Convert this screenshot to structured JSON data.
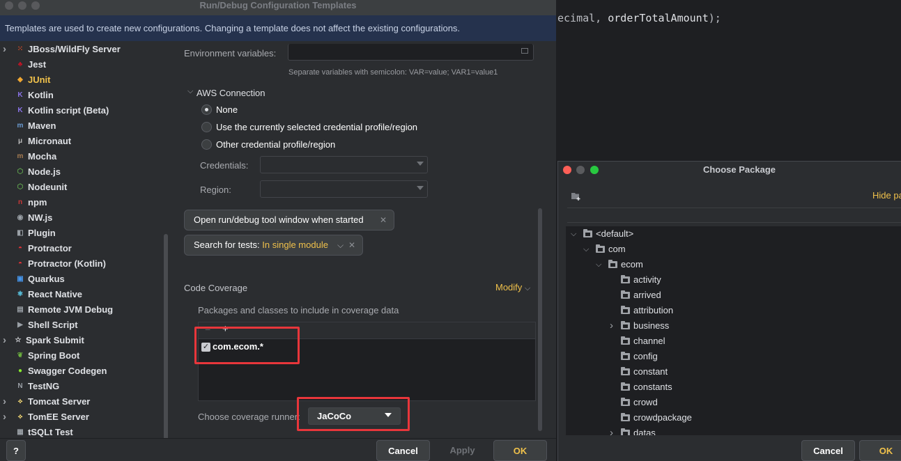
{
  "editor": {
    "code_before": "ecimal, ",
    "code_ident": "orderTotalAmount",
    "code_after": ");"
  },
  "dialog": {
    "title": "Run/Debug Configuration Templates",
    "banner": "Templates are used to create new configurations. Changing a template does not affect the existing configurations."
  },
  "sidebar": {
    "items": [
      {
        "label": "JBoss/WildFly Server",
        "icon": "jboss-icon",
        "expandable": true,
        "color": "#e44d26"
      },
      {
        "label": "Jest",
        "icon": "jest-icon",
        "expandable": false,
        "color": "#c21325"
      },
      {
        "label": "JUnit",
        "icon": "junit-icon",
        "expandable": false,
        "color": "#f0a732",
        "selected": true
      },
      {
        "label": "Kotlin",
        "icon": "kotlin-icon",
        "expandable": false,
        "color": "#8a73e8"
      },
      {
        "label": "Kotlin script (Beta)",
        "icon": "kotlin-script-icon",
        "expandable": false,
        "color": "#8a73e8"
      },
      {
        "label": "Maven",
        "icon": "maven-icon",
        "expandable": false,
        "color": "#6b9bd2"
      },
      {
        "label": "Micronaut",
        "icon": "micronaut-icon",
        "expandable": false,
        "color": "#bbbbbb"
      },
      {
        "label": "Mocha",
        "icon": "mocha-icon",
        "expandable": false,
        "color": "#a67c52"
      },
      {
        "label": "Node.js",
        "icon": "nodejs-icon",
        "expandable": false,
        "color": "#5fa04e"
      },
      {
        "label": "Nodeunit",
        "icon": "nodeunit-icon",
        "expandable": false,
        "color": "#5fa04e"
      },
      {
        "label": "npm",
        "icon": "npm-icon",
        "expandable": false,
        "color": "#cb3837"
      },
      {
        "label": "NW.js",
        "icon": "nwjs-icon",
        "expandable": false,
        "color": "#9aa0a6"
      },
      {
        "label": "Plugin",
        "icon": "plugin-icon",
        "expandable": false,
        "color": "#9aa0a6"
      },
      {
        "label": "Protractor",
        "icon": "protractor-icon",
        "expandable": false,
        "color": "#e23237"
      },
      {
        "label": "Protractor (Kotlin)",
        "icon": "protractor-kotlin-icon",
        "expandable": false,
        "color": "#e23237"
      },
      {
        "label": "Quarkus",
        "icon": "quarkus-icon",
        "expandable": false,
        "color": "#4695eb"
      },
      {
        "label": "React Native",
        "icon": "react-icon",
        "expandable": false,
        "color": "#61dafb"
      },
      {
        "label": "Remote JVM Debug",
        "icon": "remote-debug-icon",
        "expandable": false,
        "color": "#9aa0a6"
      },
      {
        "label": "Shell Script",
        "icon": "shell-icon",
        "expandable": false,
        "color": "#9aa0a6"
      },
      {
        "label": "Spark Submit",
        "icon": "spark-icon",
        "expandable": true,
        "color": "#dfe1e5"
      },
      {
        "label": "Spring Boot",
        "icon": "spring-icon",
        "expandable": false,
        "color": "#6db33f"
      },
      {
        "label": "Swagger Codegen",
        "icon": "swagger-icon",
        "expandable": false,
        "color": "#85ea2d"
      },
      {
        "label": "TestNG",
        "icon": "testng-icon",
        "expandable": false,
        "color": "#9aa0a6"
      },
      {
        "label": "Tomcat Server",
        "icon": "tomcat-icon",
        "expandable": true,
        "color": "#f8dc75"
      },
      {
        "label": "TomEE Server",
        "icon": "tomee-icon",
        "expandable": true,
        "color": "#f8dc75"
      },
      {
        "label": "tSQLt Test",
        "icon": "tsqlt-icon",
        "expandable": false,
        "color": "#9aa0a6"
      }
    ]
  },
  "content": {
    "env_label": "Environment variables:",
    "env_hint": "Separate variables with semicolon: VAR=value; VAR1=value1",
    "aws_section": "AWS Connection",
    "aws_options": [
      {
        "label": "None",
        "selected": true
      },
      {
        "label": "Use the currently selected credential profile/region",
        "selected": false
      },
      {
        "label": "Other credential profile/region",
        "selected": false
      }
    ],
    "credentials_label": "Credentials:",
    "region_label": "Region:",
    "chip_open_tool": "Open run/debug tool window when started",
    "chip_search_prefix": "Search for tests: ",
    "chip_search_value": "In single module",
    "coverage_title": "Code Coverage",
    "modify_label": "Modify",
    "coverage_desc": "Packages and classes to include in coverage data",
    "coverage_entry": "com.ecom.*",
    "runner_label": "Choose coverage runner:",
    "runner_value": "JaCoCo"
  },
  "footer": {
    "help": "?",
    "cancel": "Cancel",
    "apply": "Apply",
    "ok": "OK"
  },
  "package_dialog": {
    "title": "Choose Package",
    "hide": "Hide pa",
    "nodes": [
      {
        "label": "<default>",
        "level": 0,
        "chevron": "open"
      },
      {
        "label": "com",
        "level": 1,
        "chevron": "open"
      },
      {
        "label": "ecom",
        "level": 2,
        "chevron": "open"
      },
      {
        "label": "activity",
        "level": 3,
        "chevron": "none"
      },
      {
        "label": "arrived",
        "level": 3,
        "chevron": "none"
      },
      {
        "label": "attribution",
        "level": 3,
        "chevron": "none"
      },
      {
        "label": "business",
        "level": 3,
        "chevron": "closed"
      },
      {
        "label": "channel",
        "level": 3,
        "chevron": "none"
      },
      {
        "label": "config",
        "level": 3,
        "chevron": "none"
      },
      {
        "label": "constant",
        "level": 3,
        "chevron": "none"
      },
      {
        "label": "constants",
        "level": 3,
        "chevron": "none"
      },
      {
        "label": "crowd",
        "level": 3,
        "chevron": "none"
      },
      {
        "label": "crowdpackage",
        "level": 3,
        "chevron": "none"
      },
      {
        "label": "datas",
        "level": 3,
        "chevron": "closed"
      }
    ],
    "cancel": "Cancel",
    "ok": "OK"
  }
}
